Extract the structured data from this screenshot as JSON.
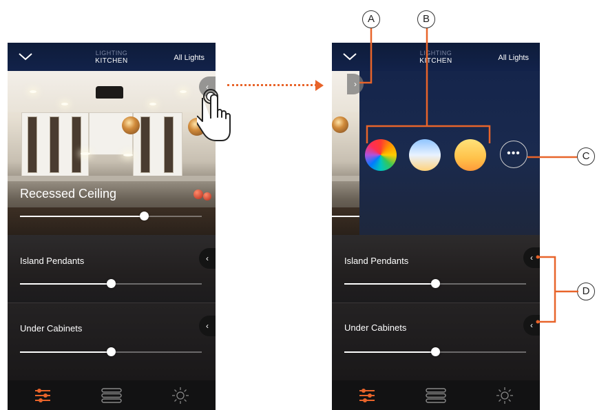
{
  "colors": {
    "accent": "#e8642a",
    "header_bg": "#12224a"
  },
  "screens": [
    {
      "header": {
        "section": "LIGHTING",
        "room": "KITCHEN",
        "all_lights": "All Lights"
      },
      "featured_zone": {
        "label": "Recessed Ceiling",
        "level": 0.68
      },
      "zones": [
        {
          "label": "Island Pendants",
          "level": 0.5
        },
        {
          "label": "Under Cabinets",
          "level": 0.5
        }
      ]
    },
    {
      "header": {
        "section": "LIGHTING",
        "room": "KITCHEN",
        "all_lights": "All Lights"
      },
      "color_swatches": [
        "full-spectrum",
        "cool-white",
        "warm-white"
      ],
      "more_label": "•••",
      "zones": [
        {
          "label": "Island Pendants",
          "level": 0.5
        },
        {
          "label": "Under Cabinets",
          "level": 0.5
        }
      ]
    }
  ],
  "icons": {
    "collapse": "chevron-down-icon",
    "tab_1": "sliders-icon",
    "tab_2": "list-icon",
    "tab_3": "sun-icon",
    "gesture": "tap-hand-icon"
  },
  "callouts": [
    "A",
    "B",
    "C",
    "D"
  ]
}
